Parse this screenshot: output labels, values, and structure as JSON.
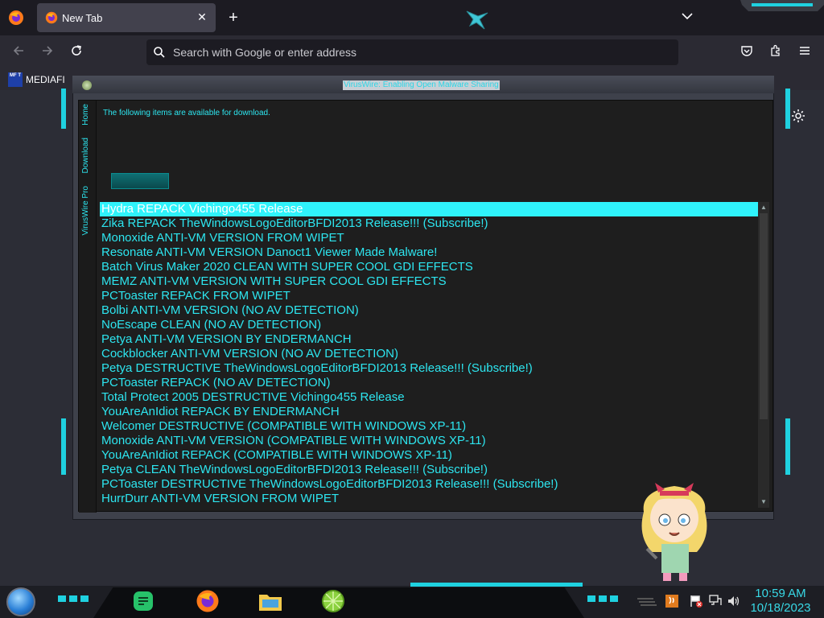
{
  "browser": {
    "tab": {
      "title": "New Tab",
      "close": "✕"
    },
    "new_tab": "+",
    "list_tabs": "⌄",
    "urlbar": {
      "placeholder": "Search with Google or enter address"
    },
    "bookmark": {
      "label": "MEDIAFI",
      "icon_text": "MF T"
    }
  },
  "app": {
    "title": "VirusWire: Enabling Open Malware Sharing",
    "sidebar_tabs": [
      "Home",
      "Download",
      "VirusWire Pro"
    ],
    "notice": "The following items are available for download.",
    "download_button": "",
    "selected_index": 0,
    "items": [
      "Hydra REPACK Vichingo455 Release",
      "Zika REPACK TheWindowsLogoEditorBFDI2013 Release!!! (Subscribe!)",
      "Monoxide ANTI-VM VERSION FROM WIPET",
      "Resonate ANTI-VM VERSION Danoct1 Viewer Made Malware!",
      "Batch Virus Maker 2020 CLEAN WITH SUPER COOL GDI EFFECTS",
      "MEMZ ANTI-VM VERSION WITH SUPER COOL GDI EFFECTS",
      "PCToaster REPACK FROM WIPET",
      "Bolbi ANTI-VM VERSION (NO AV DETECTION)",
      "NoEscape CLEAN (NO AV DETECTION)",
      "Petya ANTI-VM VERSION BY ENDERMANCH",
      "Cockblocker ANTI-VM VERSION (NO AV DETECTION)",
      "Petya DESTRUCTIVE TheWindowsLogoEditorBFDI2013 Release!!! (Subscribe!)",
      "PCToaster REPACK (NO AV DETECTION)",
      "Total Protect 2005 DESTRUCTIVE Vichingo455 Release",
      "YouAreAnIdiot REPACK BY ENDERMANCH",
      "Welcomer DESTRUCTIVE (COMPATIBLE WITH WINDOWS XP-11)",
      "Monoxide ANTI-VM VERSION (COMPATIBLE WITH WINDOWS XP-11)",
      "YouAreAnIdiot REPACK (COMPATIBLE WITH WINDOWS XP-11)",
      "Petya CLEAN TheWindowsLogoEditorBFDI2013 Release!!! (Subscribe!)",
      "PCToaster DESTRUCTIVE TheWindowsLogoEditorBFDI2013 Release!!! (Subscribe!)",
      "HurrDurr ANTI-VM VERSION FROM WIPET"
    ],
    "accent": "#2de6f0"
  },
  "taskbar": {
    "time": "10:59 AM",
    "date": "10/18/2023"
  }
}
